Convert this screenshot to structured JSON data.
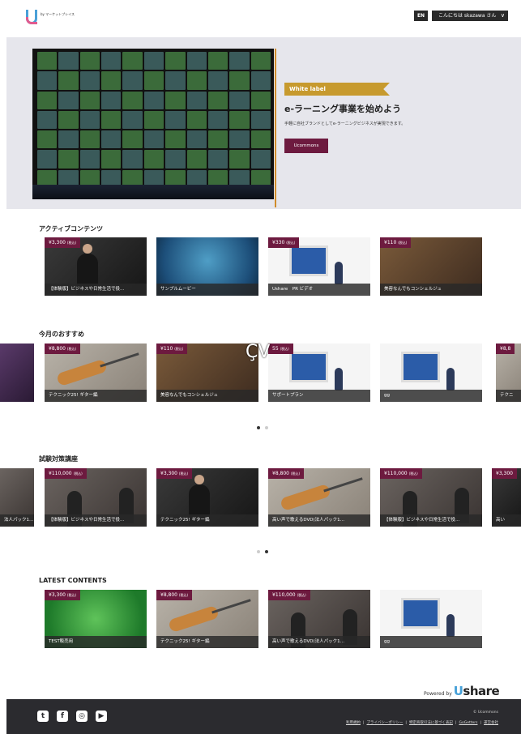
{
  "header": {
    "logo_sub": "by\nマーケットプレイス",
    "lang": "EN",
    "greeting": "こんにちは skazawa さん"
  },
  "hero": {
    "ribbon": "White label",
    "title": "e-ラーニング事業を始めよう",
    "desc": "手軽に自社ブランドとしてe-ラーニングビジネスが実現できます。",
    "button": "Ucommons"
  },
  "sections": {
    "active": {
      "title": "アクティブコンテンツ",
      "cards": [
        {
          "price": "¥3,300",
          "tax": "(税込)",
          "caption": "【体験版】ビジネスや日常生活で役…"
        },
        {
          "price": "",
          "tax": "",
          "caption": "サンプルムービー"
        },
        {
          "price": "¥330",
          "tax": "(税込)",
          "caption": "Ushare　PR ビデオ"
        },
        {
          "price": "¥110",
          "tax": "(税込)",
          "caption": "美容なんでもコンシェルジュ"
        }
      ]
    },
    "recommend": {
      "title": "今月のおすすめ",
      "cards": [
        {
          "price": "¥8,800",
          "tax": "(税込)",
          "caption": "テクニック25! ギター編"
        },
        {
          "price": "¥110",
          "tax": "(税込)",
          "caption": "美容なんでもコンシェルジュ"
        },
        {
          "price": "55",
          "tax": "(税込)",
          "caption": "サポートプラン"
        },
        {
          "price": "",
          "tax": "",
          "caption": "gg"
        },
        {
          "price": "¥8,8",
          "tax": "",
          "caption": "テクニ"
        }
      ]
    },
    "exam": {
      "title": "試験対策講座",
      "cards": [
        {
          "price": "",
          "tax": "",
          "caption": "法人パック1…"
        },
        {
          "price": "¥110,000",
          "tax": "(税込)",
          "caption": "【体験版】ビジネスや日常生活で役…"
        },
        {
          "price": "¥3,300",
          "tax": "(税込)",
          "caption": "テクニック25! ギター編"
        },
        {
          "price": "¥8,800",
          "tax": "(税込)",
          "caption": "高い声で歌えるDVD(法人パック1…"
        },
        {
          "price": "¥110,000",
          "tax": "(税込)",
          "caption": "【体験版】ビジネスや日常生活で役…"
        },
        {
          "price": "¥3,300",
          "tax": "",
          "caption": "高い"
        }
      ]
    },
    "latest": {
      "title": "LATEST CONTENTS",
      "cards": [
        {
          "price": "¥3,300",
          "tax": "(税込)",
          "caption": "TEST販売用"
        },
        {
          "price": "¥8,800",
          "tax": "(税込)",
          "caption": "テクニック25! ギター編"
        },
        {
          "price": "¥110,000",
          "tax": "(税込)",
          "caption": "高い声で歌えるDVD(法人パック1…"
        },
        {
          "price": "",
          "tax": "",
          "caption": "gg"
        }
      ]
    }
  },
  "powered": {
    "label": "Powered by",
    "brand_u": "U",
    "brand_rest": "share"
  },
  "footer": {
    "copyright": "© Ucommons",
    "links": [
      "利用規約",
      "プライバシーポリシー",
      "特定商取引法に基づく表記",
      "GoGetters",
      "運営会社"
    ],
    "social_icons": [
      "twitter-icon",
      "facebook-icon",
      "instagram-icon",
      "youtube-icon"
    ]
  },
  "overlay_text": "ÇV",
  "colors": {
    "accent": "#6d1a3f",
    "ribbon": "#c79a2e",
    "footer": "#2b2b2f"
  }
}
